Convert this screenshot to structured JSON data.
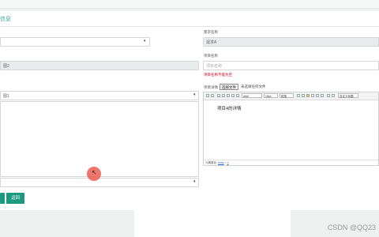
{
  "header": {
    "title": "信息"
  },
  "left_form": {
    "field1_value": "",
    "field2_value": "图2",
    "field3_value": "图1",
    "field4_value": ""
  },
  "right_form": {
    "demand_name_label": "需求名称",
    "demand_name_value": "需求A",
    "project_name_label": "项目名称",
    "project_name_placeholder": "项目名称",
    "project_name_error": "项目名称不能为空",
    "project_detail_label": "项目详情",
    "file_button": "选择文件",
    "file_status": "未选择任何文件"
  },
  "editor": {
    "font_select": "arial",
    "size_select": "16px",
    "para_select": "段落",
    "custom_select": "自定义标题",
    "content": "项目4的详情",
    "status_label": "元素路径:",
    "status_path_1": "body",
    "status_sep": " > ",
    "status_path_2": "p"
  },
  "buttons": {
    "back": "返回",
    "submit": ""
  },
  "watermark": "CSDN @QQ23"
}
